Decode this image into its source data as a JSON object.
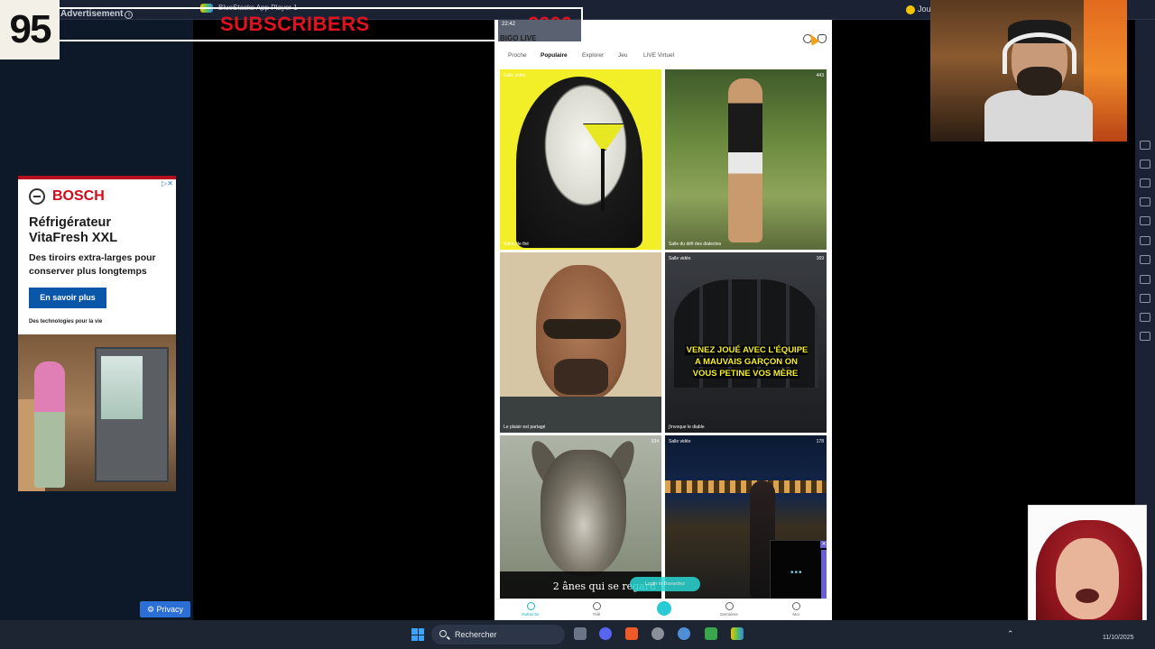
{
  "overlay": {
    "counter": "95",
    "subscribers_label": "SUBSCRIBERS",
    "subscribers_goal": "2000"
  },
  "topbar": {
    "ad_label": "Advertisement",
    "bluestacks_title": "BlueStacks App Player 1",
    "right_label": "Jou"
  },
  "ad": {
    "brand": "BOSCH",
    "headline": "Réfrigérateur VitaFresh XXL",
    "body": "Des tiroirs extra-larges pour conserver plus longtemps",
    "cta": "En savoir plus",
    "tagline": "Des technologies pour la vie",
    "privacy": "Privacy"
  },
  "phone": {
    "time": "22:42",
    "app_title": "BIGO LIVE",
    "tabs": [
      "Proche",
      "Populaire",
      "Explorer",
      "Jeu",
      "LIVE Virtuel"
    ],
    "active_tab": "Populaire",
    "tiles": [
      {
        "caption": "Salon de thé",
        "badge": "Salle vidéo"
      },
      {
        "caption": "Salle du défi des dialectes",
        "viewers": "443"
      },
      {
        "caption": "Le plaisir est partagé",
        "viewers": ""
      },
      {
        "caption": "j'invoque le diable",
        "badge": "Salle vidéo",
        "viewers": "169",
        "banner": "VENEZ JOUÉ AVEC L'ÉQUIPE A MAUVAIS GARÇON ON VOUS PETINE VOS MÈRE"
      },
      {
        "caption": "2 ânes qui se regard",
        "viewers": "334"
      },
      {
        "caption": "",
        "badge": "Salle vidéo",
        "viewers": "178"
      }
    ],
    "login_button": "Login to Bavardez",
    "nav": [
      "Rafraîchir",
      "Télé",
      "",
      "Dernières",
      "Moi"
    ]
  },
  "taskbar": {
    "search_placeholder": "Rechercher",
    "date": "11/10/2025"
  },
  "colors": {
    "subscriber_red": "#e0121f",
    "bosch_red": "#d10a16",
    "bosch_blue": "#0a56a8",
    "bigo_teal": "#16b7c4",
    "banner_yellow": "#f5ee28"
  }
}
